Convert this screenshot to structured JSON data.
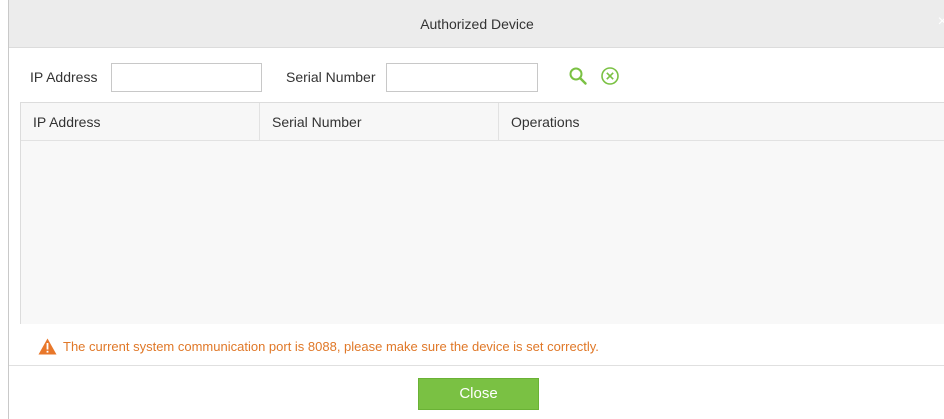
{
  "dialog": {
    "title": "Authorized Device",
    "close_glyph": "×"
  },
  "filters": {
    "ip_label": "IP Address",
    "ip_value": "",
    "serial_label": "Serial Number",
    "serial_value": "",
    "search_icon": "search-icon",
    "clear_icon": "clear-circle-icon"
  },
  "table": {
    "columns": [
      "IP Address",
      "Serial Number",
      "Operations"
    ],
    "rows": []
  },
  "warning": {
    "icon": "warning-triangle-icon",
    "text": "The current system communication port is 8088, please make sure the device is set correctly."
  },
  "footer": {
    "close_label": "Close"
  },
  "colors": {
    "accent_green": "#7ac143",
    "warning_orange": "#e07828",
    "titlebar_bg": "#ececec"
  }
}
